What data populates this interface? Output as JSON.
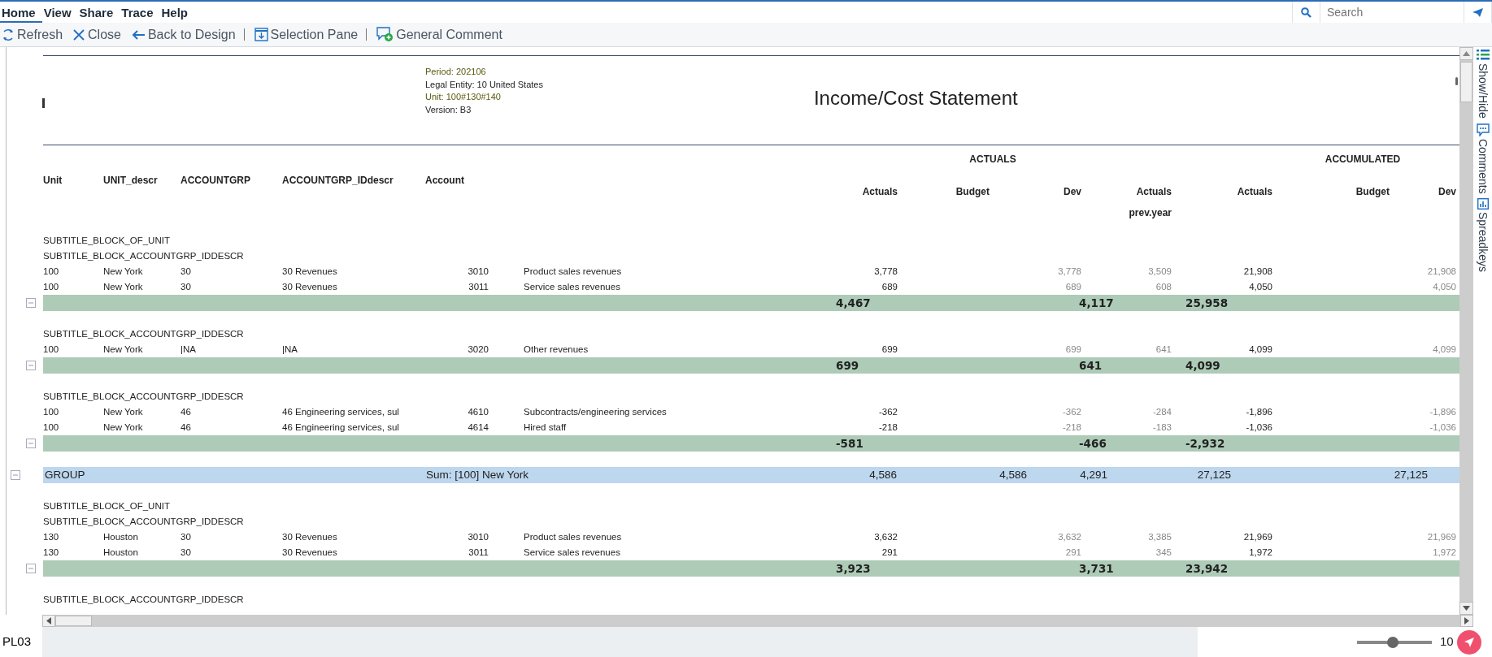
{
  "menu": [
    {
      "label": "Home",
      "selected": true
    },
    {
      "label": "View",
      "selected": false
    },
    {
      "label": "Share",
      "selected": false
    },
    {
      "label": "Trace",
      "selected": false
    },
    {
      "label": "Help",
      "selected": false
    }
  ],
  "search": {
    "placeholder": "Search"
  },
  "toolbar": [
    {
      "label": "Refresh",
      "kind": "refresh",
      "divider_before": false
    },
    {
      "label": "Close",
      "kind": "close",
      "divider_before": false
    },
    {
      "label": "Back to Design",
      "kind": "back",
      "divider_before": false
    },
    {
      "label": "Selection Pane",
      "kind": "pane",
      "divider_before": true
    },
    {
      "label": "General Comment",
      "kind": "comment",
      "divider_before": true
    }
  ],
  "report": {
    "meta": [
      {
        "text": "Period: 202106",
        "emphasis": true
      },
      {
        "text": "Legal Entity: 10 United States",
        "emphasis": false
      },
      {
        "text": "Unit: 100#130#140",
        "emphasis": true
      },
      {
        "text": "Version: B3",
        "emphasis": false
      }
    ],
    "title": "Income/Cost Statement",
    "column_groups": [
      "ACTUALS",
      "ACCUMULATED"
    ],
    "columns": [
      "Unit",
      "UNIT_descr",
      "ACCOUNTGRP",
      "ACCOUNTGRP_IDdescr",
      "Account"
    ],
    "value_columns": [
      "Actuals",
      "Budget",
      "Dev",
      "Actuals\nprev.year",
      "Actuals",
      "Budget",
      "Dev"
    ],
    "rows": [
      {
        "kind": "subtitle",
        "text": "SUBTITLE_BLOCK_OF_UNIT"
      },
      {
        "kind": "subtitle",
        "text": "SUBTITLE_BLOCK_ACCOUNTGRP_IDDESCR"
      },
      {
        "kind": "data",
        "unit": "100",
        "unit_descr": "New York",
        "accountgrp": "30",
        "accountgrp_descr": "30 Revenues",
        "account": "3010",
        "account_descr": "Product sales revenues",
        "actuals": "3,778",
        "dev": "3,778",
        "actuals_prev": "3,509",
        "acc_actuals": "21,908",
        "acc_dev": "21,908"
      },
      {
        "kind": "data",
        "unit": "100",
        "unit_descr": "New York",
        "accountgrp": "30",
        "accountgrp_descr": "30 Revenues",
        "account": "3011",
        "account_descr": "Service sales revenues",
        "actuals": "689",
        "dev": "689",
        "actuals_prev": "608",
        "acc_actuals": "4,050",
        "acc_dev": "4,050"
      },
      {
        "kind": "subtotal",
        "values": [
          "4,467",
          "4,117",
          "25,958"
        ]
      },
      {
        "kind": "spacer"
      },
      {
        "kind": "subtitle",
        "text": "SUBTITLE_BLOCK_ACCOUNTGRP_IDDESCR"
      },
      {
        "kind": "data",
        "unit": "100",
        "unit_descr": "New York",
        "accountgrp": "|NA",
        "accountgrp_descr": "|NA",
        "account": "3020",
        "account_descr": "Other revenues",
        "actuals": "699",
        "dev": "699",
        "actuals_prev": "641",
        "acc_actuals": "4,099",
        "acc_dev": "4,099"
      },
      {
        "kind": "subtotal",
        "values": [
          "699",
          "641",
          "4,099"
        ]
      },
      {
        "kind": "spacer"
      },
      {
        "kind": "subtitle",
        "text": "SUBTITLE_BLOCK_ACCOUNTGRP_IDDESCR"
      },
      {
        "kind": "data",
        "unit": "100",
        "unit_descr": "New York",
        "accountgrp": "46",
        "accountgrp_descr": "46 Engineering services, sul",
        "account": "4610",
        "account_descr": "Subcontracts/engineering services",
        "actuals": "-362",
        "dev": "-362",
        "actuals_prev": "-284",
        "acc_actuals": "-1,896",
        "acc_dev": "-1,896"
      },
      {
        "kind": "data",
        "unit": "100",
        "unit_descr": "New York",
        "accountgrp": "46",
        "accountgrp_descr": "46 Engineering services, sul",
        "account": "4614",
        "account_descr": "Hired staff",
        "actuals": "-218",
        "dev": "-218",
        "actuals_prev": "-183",
        "acc_actuals": "-1,036",
        "acc_dev": "-1,036"
      },
      {
        "kind": "subtotal",
        "values": [
          "-581",
          "-466",
          "-2,932"
        ]
      },
      {
        "kind": "spacer"
      },
      {
        "kind": "group",
        "label": "GROUP",
        "sum": "Sum: [100] New York",
        "values": [
          "4,586",
          "4,586",
          "4,291",
          "27,125",
          "27,125"
        ]
      },
      {
        "kind": "spacer"
      },
      {
        "kind": "subtitle",
        "text": "SUBTITLE_BLOCK_OF_UNIT"
      },
      {
        "kind": "subtitle",
        "text": "SUBTITLE_BLOCK_ACCOUNTGRP_IDDESCR"
      },
      {
        "kind": "data",
        "unit": "130",
        "unit_descr": "Houston",
        "accountgrp": "30",
        "accountgrp_descr": "30 Revenues",
        "account": "3010",
        "account_descr": "Product sales revenues",
        "actuals": "3,632",
        "dev": "3,632",
        "actuals_prev": "3,385",
        "acc_actuals": "21,969",
        "acc_dev": "21,969"
      },
      {
        "kind": "data",
        "unit": "130",
        "unit_descr": "Houston",
        "accountgrp": "30",
        "accountgrp_descr": "30 Revenues",
        "account": "3011",
        "account_descr": "Service sales revenues",
        "actuals": "291",
        "dev": "291",
        "actuals_prev": "345",
        "acc_actuals": "1,972",
        "acc_dev": "1,972"
      },
      {
        "kind": "subtotal",
        "values": [
          "3,923",
          "3,731",
          "23,942"
        ]
      },
      {
        "kind": "spacer"
      },
      {
        "kind": "subtitle",
        "text": "SUBTITLE_BLOCK_ACCOUNTGRP_IDDESCR"
      }
    ]
  },
  "side_panel": [
    {
      "label": "Show/Hide",
      "kind": "list"
    },
    {
      "label": "Comments",
      "kind": "comments"
    },
    {
      "label": "Spreadkeys",
      "kind": "chart"
    }
  ],
  "status_bar": {
    "sheet": "PL03",
    "zoom": {
      "level": 0.48,
      "reading": "10"
    }
  }
}
